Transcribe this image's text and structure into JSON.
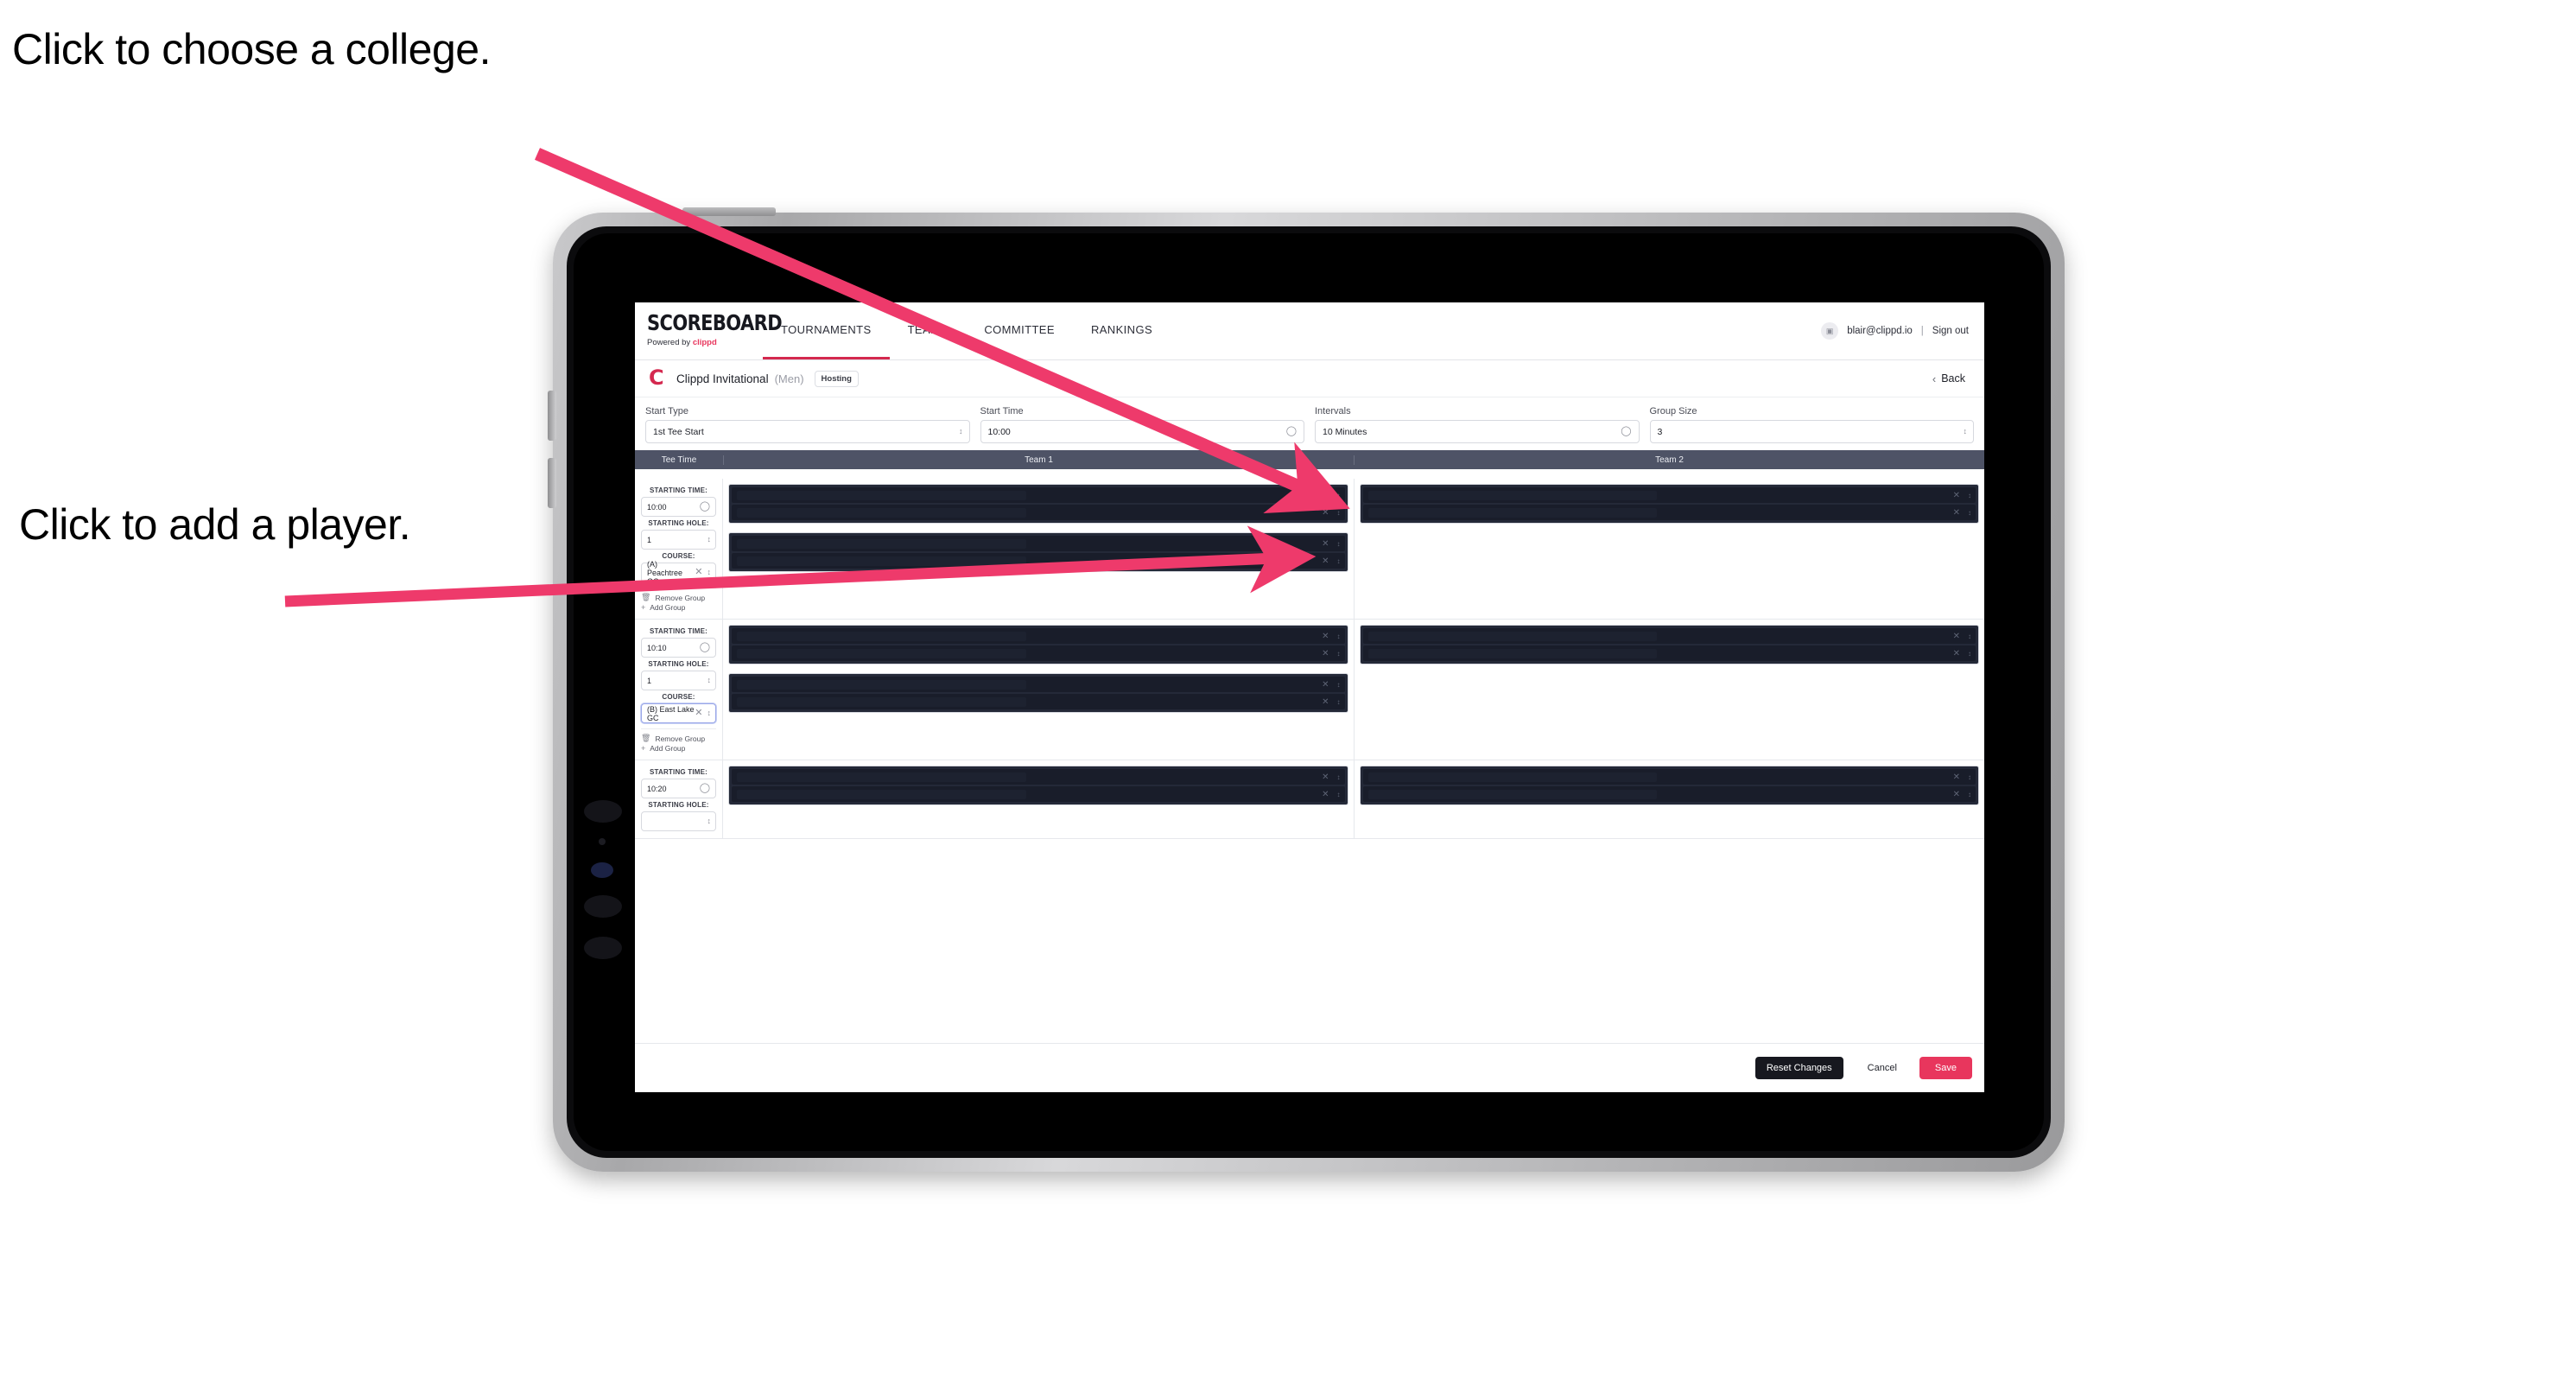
{
  "annotations": [
    {
      "id": "choose-college",
      "text": "Click to choose a college."
    },
    {
      "id": "add-player",
      "text": "Click to add a player."
    }
  ],
  "colors": {
    "accent_pink": "#e8365d",
    "nav_active_underline": "#d4294f",
    "table_header_bg": "#4e5366",
    "player_row_bg": "#191d2a",
    "dark_button": "#17181f",
    "arrow_pink": "#ee3a6b"
  },
  "app": {
    "logo": {
      "title": "SCOREBOARD",
      "powered_prefix": "Powered by",
      "powered_brand": "clippd"
    },
    "nav": [
      {
        "label": "TOURNAMENTS",
        "active": true
      },
      {
        "label": "TEAMS",
        "active": false
      },
      {
        "label": "COMMITTEE",
        "active": false
      },
      {
        "label": "RANKINGS",
        "active": false
      }
    ],
    "user": {
      "avatar_icon": "user-icon",
      "email": "blair@clippd.io",
      "separator": "|",
      "sign_out": "Sign out"
    },
    "event": {
      "logo_letter": "C",
      "name": "Clippd Invitational",
      "gender": "(Men)",
      "badge": "Hosting",
      "back_label": "Back",
      "back_icon": "chevron-left-icon"
    },
    "settings": [
      {
        "label": "Start Type",
        "value": "1st Tee Start",
        "icon": "chevron-updown-icon"
      },
      {
        "label": "Start Time",
        "value": "10:00",
        "icon": "clock-icon"
      },
      {
        "label": "Intervals",
        "value": "10 Minutes",
        "icon": "clock-icon"
      },
      {
        "label": "Group Size",
        "value": "3",
        "icon": "chevron-updown-icon"
      }
    ],
    "table": {
      "columns": [
        "Tee Time",
        "Team 1",
        "Team 2"
      ],
      "field_labels": {
        "time": "STARTING TIME:",
        "hole": "STARTING HOLE:",
        "course": "COURSE:"
      },
      "actions": {
        "remove_group": "Remove Group",
        "add_group": "Add Group",
        "remove_icon": "trash-icon",
        "add_icon": "plus-icon"
      },
      "groups": [
        {
          "starting_time": "10:00",
          "starting_hole": "1",
          "course": "(A) Peachtree GC",
          "course_focused": false,
          "course_clear_icon": "close-icon",
          "team1_blocks": [
            {
              "players": 2
            },
            {
              "players": 2
            }
          ],
          "team2_blocks": [
            {
              "players": 2
            }
          ]
        },
        {
          "starting_time": "10:10",
          "starting_hole": "1",
          "course": "(B) East Lake GC",
          "course_focused": true,
          "course_clear_icon": "close-icon",
          "team1_blocks": [
            {
              "players": 2
            },
            {
              "players": 2
            }
          ],
          "team2_blocks": [
            {
              "players": 2
            }
          ]
        },
        {
          "starting_time": "10:20",
          "starting_hole": "",
          "course": "",
          "course_focused": false,
          "course_clear_icon": "close-icon",
          "team1_blocks": [
            {
              "players": 2
            }
          ],
          "team2_blocks": [
            {
              "players": 2
            }
          ]
        }
      ]
    },
    "footer": {
      "reset_label": "Reset Changes",
      "cancel_label": "Cancel",
      "save_label": "Save"
    }
  }
}
